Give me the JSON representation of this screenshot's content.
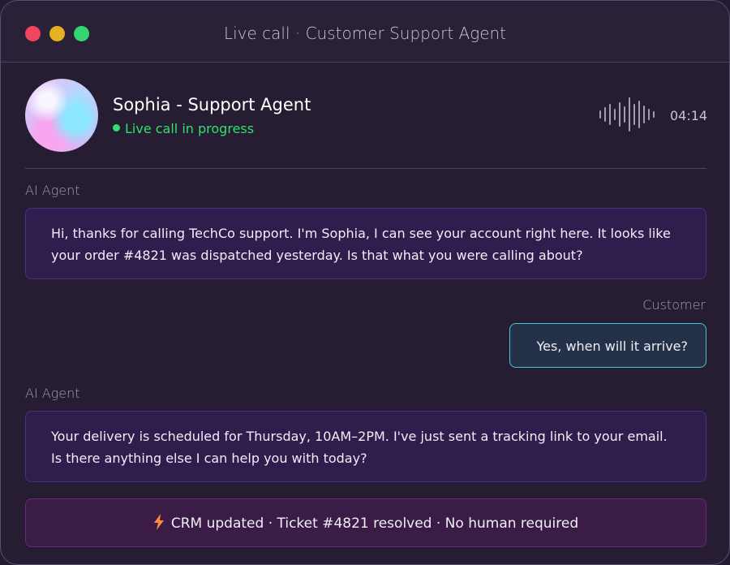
{
  "window": {
    "title": "Live call · Customer Support Agent"
  },
  "header": {
    "agent_name": "Sophia - Support Agent",
    "status": "Live call in progress",
    "timer": "04:14",
    "status_color": "#2ee06e"
  },
  "conversation": [
    {
      "speaker": "AI Agent",
      "text": "Hi, thanks for calling TechCo support. I'm Sophia, I can see your account right here. It looks like your order #4821 was dispatched yesterday. Is that what you were calling about?"
    },
    {
      "speaker": "Customer",
      "text": "Yes, when will it arrive?"
    },
    {
      "speaker": "AI Agent",
      "text": "Your delivery is scheduled for Thursday, 10AM–2PM. I've just sent a tracking link to your email. Is there anything else I can help you with today?"
    }
  ],
  "crm_notice": {
    "icon": "lightning-bolt-icon",
    "text": "CRM updated · Ticket #4821 resolved · No human required"
  },
  "colors": {
    "agent_bubble_border": "#4a2f86",
    "customer_bubble_border": "#48c4d2",
    "crm_border": "#6c2a78"
  }
}
